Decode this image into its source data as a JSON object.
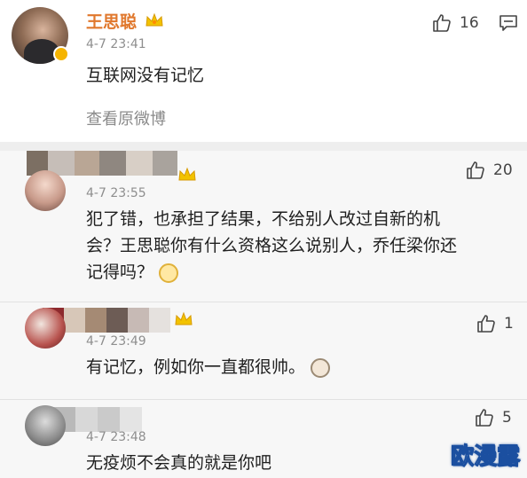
{
  "post": {
    "author": "王思聪",
    "time": "4-7 23:41",
    "text": "互联网没有记忆",
    "view_original": "查看原微博",
    "likes": "16"
  },
  "replies": [
    {
      "author": "",
      "time": "4-7 23:55",
      "text": "犯了错，也承担了结果，不给别人改过自新的机会？王思聪你有什么资格这么说别人，乔任梁你还记得吗？",
      "likes": "20"
    },
    {
      "author": "",
      "time": "4-7 23:49",
      "text": "有记忆，例如你一直都很帅。",
      "likes": "1"
    },
    {
      "author": "",
      "time": "4-7 23:48",
      "text": "无疫烦不会真的就是你吧",
      "likes": "5"
    }
  ],
  "watermark": "欧漫露",
  "colors": {
    "username": "#e0782d",
    "badge": "#f5b400",
    "watermark_stroke": "#1b4fa0"
  },
  "icons": {
    "like": "thumbs-up-icon",
    "comment": "comment-bubble-icon",
    "badge": "crown-icon",
    "verified": "verified-badge-icon"
  }
}
